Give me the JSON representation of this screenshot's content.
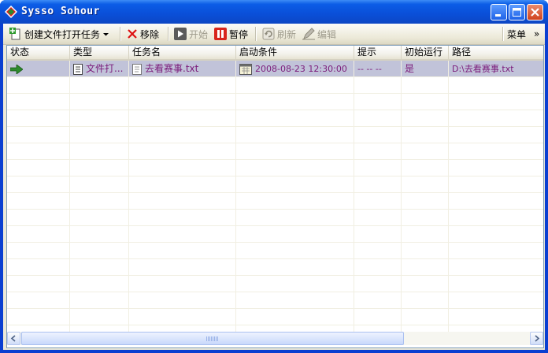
{
  "window": {
    "title": "Sysso Sohour"
  },
  "toolbar": {
    "create": "创建文件打开任务",
    "remove": "移除",
    "start": "开始",
    "pause": "暂停",
    "refresh": "刷新",
    "edit": "编辑",
    "menu": "菜单",
    "more": "»"
  },
  "columns": [
    "状态",
    "类型",
    "任务名",
    "启动条件",
    "提示",
    "初始运行",
    "路径"
  ],
  "rows": [
    {
      "status_icon": "green-arrow-right-icon",
      "type": "文件打...",
      "name": "去看赛事.txt",
      "condition": "2008-08-23 12:30:00",
      "hint": "-- -- --",
      "initial_run": "是",
      "path": "D:\\去看赛事.txt",
      "selected": true
    }
  ],
  "colors": {
    "selected_row": "#c1c3d9",
    "row_text": "#7a1a7a",
    "title_bar": "#0b5ce6"
  }
}
